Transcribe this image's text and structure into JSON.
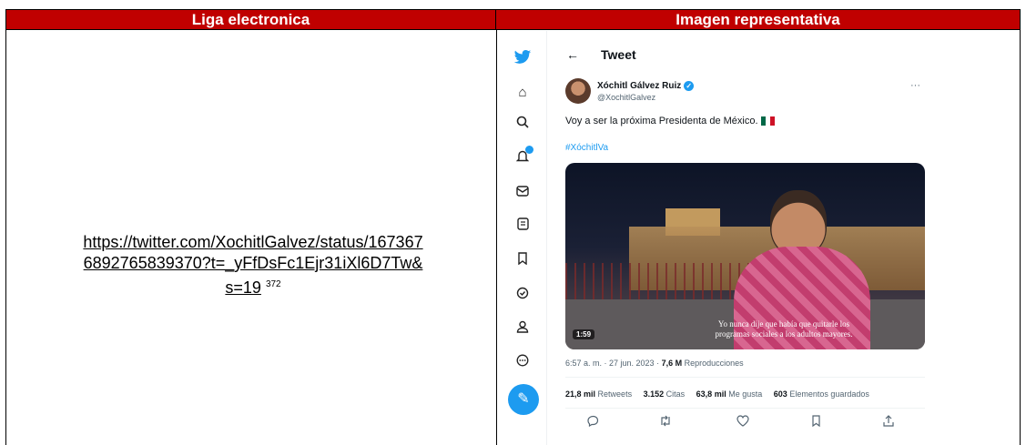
{
  "table": {
    "header_left": "Liga electronica",
    "header_right": "Imagen representativa",
    "link_line1": "https://twitter.com/XochitlGalvez/status/167367",
    "link_line2": "6892765839370?t=_yFfDsFc1Ejr31iXl6D7Tw&",
    "link_line3": "s=19",
    "footnote": "372"
  },
  "tweet": {
    "back_icon": "arrow-left-icon",
    "title": "Tweet",
    "author_name": "Xóchitl Gálvez Ruiz",
    "handle": "@XochitlGalvez",
    "more": "···",
    "text": "Voy a ser la próxima Presidenta de México.",
    "hashtag": "#XóchitlVa",
    "video_subtitle": "Yo nunca dije que había que quitarle los programas sociales a los adultos mayores.",
    "video_duration": "1:59",
    "timestamp": "6:57 a. m. · 27 jun. 2023 ·",
    "views_count": "7,6 M",
    "views_label": "Reproducciones",
    "retweets_count": "21,8 mil",
    "retweets_label": "Retweets",
    "quotes_count": "3.152",
    "quotes_label": "Citas",
    "likes_count": "63,8 mil",
    "likes_label": "Me gusta",
    "bookmarks_count": "603",
    "bookmarks_label": "Elementos guardados",
    "accent_color": "#1d9bf0"
  },
  "sidebar_icons": [
    "twitter-bird-icon",
    "home-icon",
    "search-icon",
    "notifications-icon",
    "messages-icon",
    "lists-icon",
    "bookmarks-icon",
    "verified-icon",
    "profile-icon",
    "more-icon",
    "compose-icon"
  ]
}
